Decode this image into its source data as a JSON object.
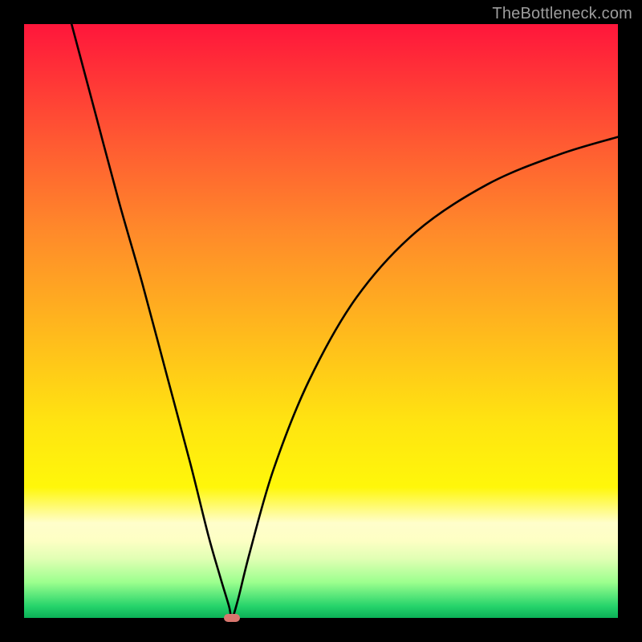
{
  "watermark": "TheBottleneck.com",
  "chart_data": {
    "type": "line",
    "title": "",
    "xlabel": "",
    "ylabel": "",
    "xlim": [
      0,
      100
    ],
    "ylim": [
      0,
      100
    ],
    "grid": false,
    "background": "red-yellow-green vertical gradient",
    "minimum_marker": {
      "x": 35,
      "y": 0
    },
    "series": [
      {
        "name": "curve",
        "color": "#000000",
        "x": [
          8,
          12,
          16,
          20,
          24,
          28,
          31,
          33,
          34.5,
          35,
          36,
          38,
          42,
          48,
          56,
          66,
          78,
          90,
          100
        ],
        "y": [
          100,
          85,
          70,
          56,
          41,
          26,
          14,
          7,
          2,
          0,
          3,
          11,
          25,
          40,
          54,
          65,
          73,
          78,
          81
        ]
      }
    ]
  }
}
